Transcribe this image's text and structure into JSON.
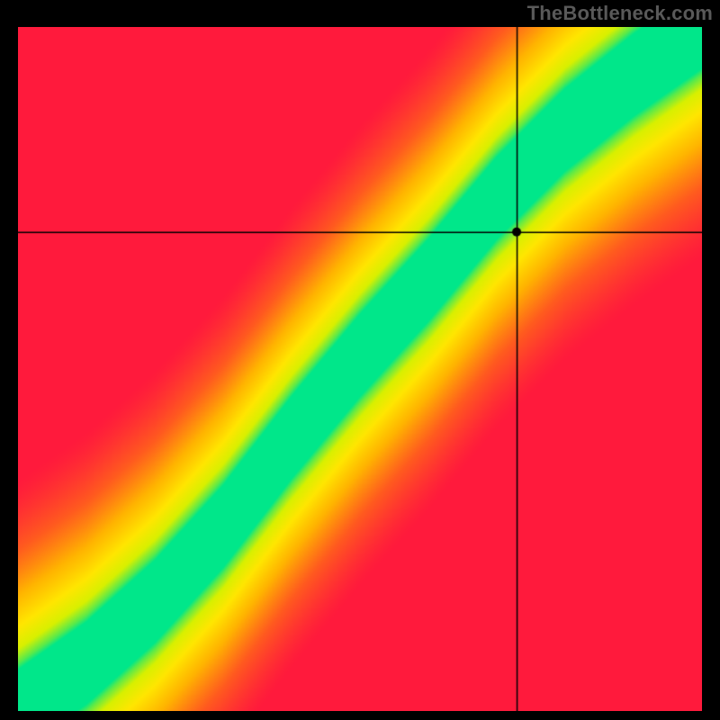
{
  "watermark": "TheBottleneck.com",
  "chart_data": {
    "type": "heatmap",
    "title": "",
    "xlabel": "",
    "ylabel": "",
    "xlim": [
      0,
      100
    ],
    "ylim": [
      0,
      100
    ],
    "crosshair": {
      "x": 73,
      "y": 70
    },
    "marker": {
      "x": 73,
      "y": 70,
      "radius": 5
    },
    "optimal_curve_description": "S-shaped ridge (green) from bottom-left to top-right representing balanced component pairing; distance from ridge encodes bottleneck severity via red→yellow→green gradient.",
    "optimal_curve_points": [
      {
        "x": 0,
        "y": 0
      },
      {
        "x": 10,
        "y": 7
      },
      {
        "x": 20,
        "y": 16
      },
      {
        "x": 30,
        "y": 27
      },
      {
        "x": 40,
        "y": 40
      },
      {
        "x": 50,
        "y": 52
      },
      {
        "x": 60,
        "y": 63
      },
      {
        "x": 70,
        "y": 75
      },
      {
        "x": 80,
        "y": 85
      },
      {
        "x": 90,
        "y": 93
      },
      {
        "x": 100,
        "y": 100
      }
    ],
    "color_stops": [
      {
        "t": 0.0,
        "color": "#ff1a3c"
      },
      {
        "t": 0.25,
        "color": "#ff5a1f"
      },
      {
        "t": 0.5,
        "color": "#ffb400"
      },
      {
        "t": 0.7,
        "color": "#ffe600"
      },
      {
        "t": 0.85,
        "color": "#d8f000"
      },
      {
        "t": 0.95,
        "color": "#5aea4a"
      },
      {
        "t": 1.0,
        "color": "#00e78a"
      }
    ],
    "ridge_halfwidth": 6.0,
    "falloff": 28.0
  }
}
